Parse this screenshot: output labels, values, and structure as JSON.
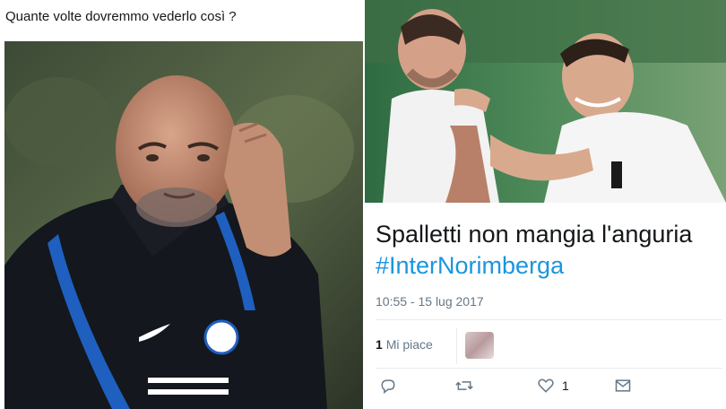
{
  "left": {
    "caption": "Quante volte dovremmo vederlo così ?",
    "photo_icon": "coach-scratching-head-photo"
  },
  "right": {
    "photo_icon": "two-players-laughing-photo",
    "tweet_text": "Spalletti non mangia l'anguria",
    "hashtag": "#InterNorimberga",
    "timestamp": "10:55 - 15 lug 2017",
    "likes_count": "1",
    "likes_label": "Mi piace",
    "actions": {
      "reply_icon": "reply-icon",
      "retweet_icon": "retweet-icon",
      "like_icon": "heart-icon",
      "like_count": "1",
      "dm_icon": "envelope-icon"
    }
  },
  "colors": {
    "hashtag": "#1b95e0",
    "meta": "#657786",
    "text": "#14171a"
  }
}
